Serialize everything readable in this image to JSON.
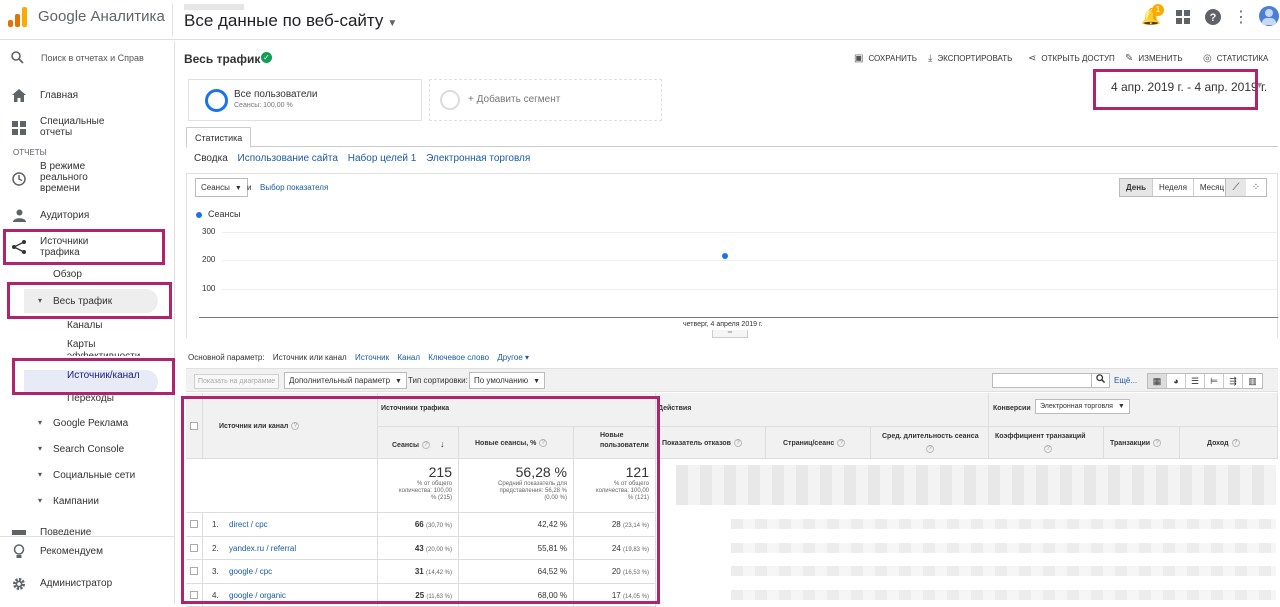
{
  "header": {
    "app_title": "Google Аналитика",
    "view_title": "Все данные по веб-сайту",
    "notification_count": "1",
    "logo_colors": [
      "#f9ab00",
      "#e37400",
      "#e37400"
    ]
  },
  "sidebar": {
    "search_placeholder": "Поиск в отчетах и Справ",
    "home": "Главная",
    "custom_reports": "Специальные отчеты",
    "reports_label": "ОТЧЕТЫ",
    "realtime": "В режиме реального времени",
    "audience": "Аудитория",
    "acquisition": "Источники трафика",
    "overview": "Обзор",
    "all_traffic": "Весь трафик",
    "channels": "Каналы",
    "treemaps": "Карты эффективности",
    "source_medium": "Источник/канал",
    "referrals": "Переходы",
    "google_ads": "Google Реклама",
    "search_console": "Search Console",
    "social": "Социальные сети",
    "campaigns": "Кампании",
    "behavior": "Поведение",
    "discover": "Рекомендуем",
    "admin": "Администратор"
  },
  "report": {
    "title": "Весь трафик",
    "actions": {
      "save": "СОХРАНИТЬ",
      "export": "ЭКСПОРТИРОВАТЬ",
      "share": "ОТКРЫТЬ ДОСТУП",
      "edit": "ИЗМЕНИТЬ",
      "insights": "СТАТИСТИКА"
    },
    "segment": {
      "name": "Все пользователи",
      "sub": "Сеансы: 100,00 %",
      "add": "+ Добавить сегмент"
    },
    "date_range": "4 апр. 2019 г. - 4 апр. 2019 г.",
    "tab": "Статистика",
    "subtabs": [
      "Сводка",
      "Использование сайта",
      "Набор целей 1",
      "Электронная торговля"
    ]
  },
  "chart_controls": {
    "metric": "Сеансы",
    "and": "и",
    "choose_metric": "Выбор показателя",
    "periods": [
      "День",
      "Неделя",
      "Месяц"
    ]
  },
  "chart_data": {
    "type": "line",
    "series": [
      {
        "name": "Сеансы",
        "values": [
          215
        ]
      }
    ],
    "x": [
      "четверг, 4 апреля 2019 г."
    ],
    "yticks": [
      "300",
      "200",
      "100"
    ],
    "ylim": [
      0,
      300
    ],
    "legend": "top-left",
    "grid": true,
    "color": "#1a73e8"
  },
  "dimensions": {
    "label": "Основной параметр:",
    "active": "Источник или канал",
    "items": [
      "Источник",
      "Канал",
      "Ключевое слово",
      "Другое ▾"
    ]
  },
  "toolbar": {
    "plot_rows": "Показать на диаграмме",
    "secondary_dim": "Дополнительный параметр",
    "sort_type_label": "Тип сортировки:",
    "sort_type": "По умолчанию",
    "advanced": "Ещё..."
  },
  "table": {
    "dim_header": "Источник или канал",
    "group_acquisition": "Источники трафика",
    "group_behavior": "Действия",
    "group_conversions": "Конверсии",
    "conversion_select": "Электронная торговля",
    "cols": {
      "sessions": "Сеансы",
      "new_sessions": "Новые сеансы, %",
      "new_users": "Новые пользователи",
      "bounce": "Показатель отказов",
      "pages": "Страниц/сеанс",
      "duration": "Сред. длительность сеанса",
      "conv_rate": "Коэффициент транзакций",
      "transactions": "Транзакции",
      "revenue": "Доход"
    },
    "totals": {
      "sessions": "215",
      "sessions_note": "% от общего количества: 100,00 % (215)",
      "new_sessions": "56,28 %",
      "new_sessions_note": "Средний показатель для представления: 56,28 % (0,00 %)",
      "new_users": "121",
      "new_users_note": "% от общего количества: 100,00 % (121)"
    },
    "rows": [
      {
        "n": "1.",
        "name": "direct / cpc",
        "sessions": "66",
        "sessions_pct": "(30,70 %)",
        "new_sessions": "42,42 %",
        "new_users": "28",
        "new_users_pct": "(23,14 %)"
      },
      {
        "n": "2.",
        "name": "yandex.ru / referral",
        "sessions": "43",
        "sessions_pct": "(20,00 %)",
        "new_sessions": "55,81 %",
        "new_users": "24",
        "new_users_pct": "(19,83 %)"
      },
      {
        "n": "3.",
        "name": "google / cpc",
        "sessions": "31",
        "sessions_pct": "(14,42 %)",
        "new_sessions": "64,52 %",
        "new_users": "20",
        "new_users_pct": "(16,53 %)"
      },
      {
        "n": "4.",
        "name": "google / organic",
        "sessions": "25",
        "sessions_pct": "(11,63 %)",
        "new_sessions": "68,00 %",
        "new_users": "17",
        "new_users_pct": "(14,05 %)"
      }
    ]
  }
}
